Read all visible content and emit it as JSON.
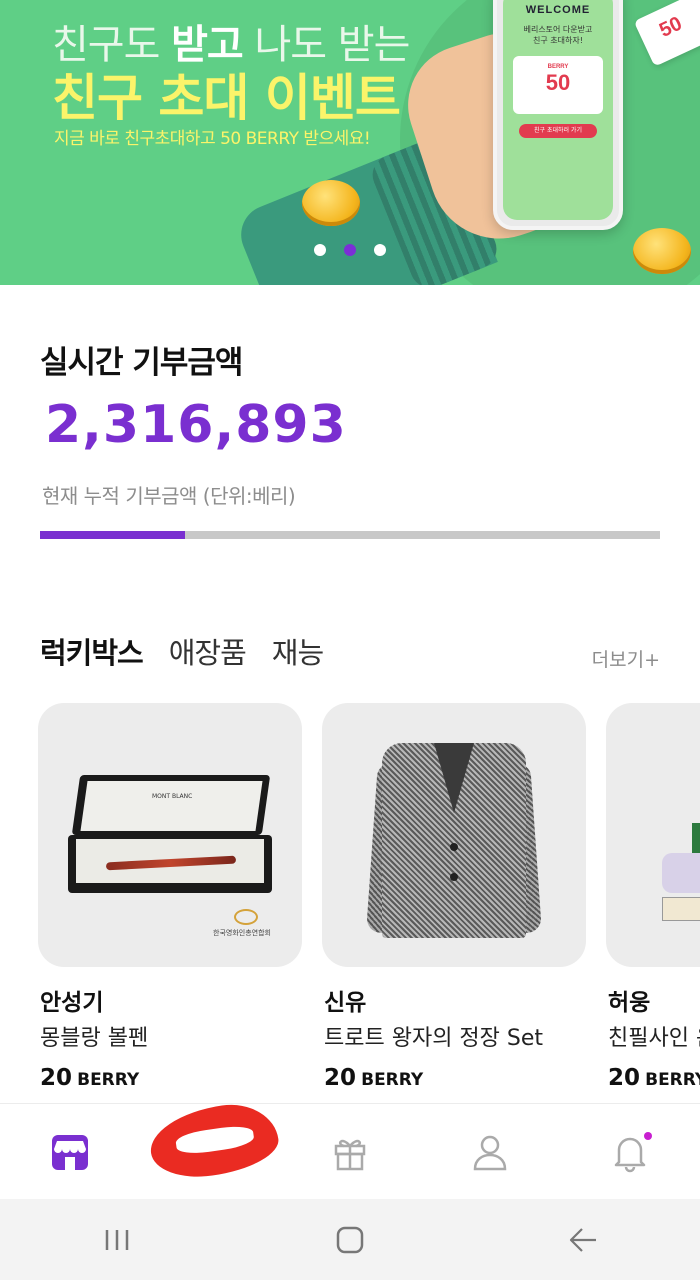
{
  "banner": {
    "headline_parts": [
      "친구도 ",
      "받고",
      " 나도 받는"
    ],
    "title": "친구 초대 이벤트",
    "subtitle": "지금 바로 친구초대하고 50 BERRY 받으세요!",
    "phone": {
      "welcome": "WELCOME",
      "sub_line1": "베리스토어 다운받고",
      "sub_line2": "친구 초대하자!",
      "ticket_label": "BERRY",
      "ticket_value": "50",
      "button_label": "친구 초대하러 가기"
    },
    "coupon_value": "50",
    "carousel": {
      "count": 3,
      "active_index": 1
    }
  },
  "donation": {
    "title": "실시간 기부금액",
    "amount": "2,316,893",
    "subtitle": "현재 누적 기부금액 (단위:베리)",
    "progress_fraction": 0.234
  },
  "tabs": {
    "items": [
      {
        "label": "럭키박스",
        "active": true
      },
      {
        "label": "애장품",
        "active": false
      },
      {
        "label": "재능",
        "active": false
      }
    ],
    "more_label": "더보기+"
  },
  "cards": [
    {
      "artist": "안성기",
      "product": "몽블랑 볼펜",
      "price": "20",
      "unit": "BERRY",
      "image_caption": "한국영화인총연합회",
      "brand_text": "MONT BLANC"
    },
    {
      "artist": "신유",
      "product": "트로트 왕자의  정장 Set",
      "price": "20",
      "unit": "BERRY"
    },
    {
      "artist": "허웅",
      "product": "친필사인 운",
      "price": "20",
      "unit": "BERRY"
    }
  ],
  "bottom_nav": [
    {
      "icon": "store-icon",
      "active": true
    },
    {
      "icon": "wallet-icon",
      "active": false
    },
    {
      "icon": "gift-icon",
      "active": false
    },
    {
      "icon": "person-icon",
      "active": false
    },
    {
      "icon": "bell-icon",
      "active": false,
      "has_badge": true
    }
  ],
  "colors": {
    "accent": "#7a2fd0",
    "banner_bg": "#5fcf86",
    "banner_title": "#fbf46a",
    "badge": "#c81fd0",
    "scribble": "#ea2b22"
  },
  "system_nav": [
    "recent-apps-icon",
    "home-icon",
    "back-icon"
  ]
}
